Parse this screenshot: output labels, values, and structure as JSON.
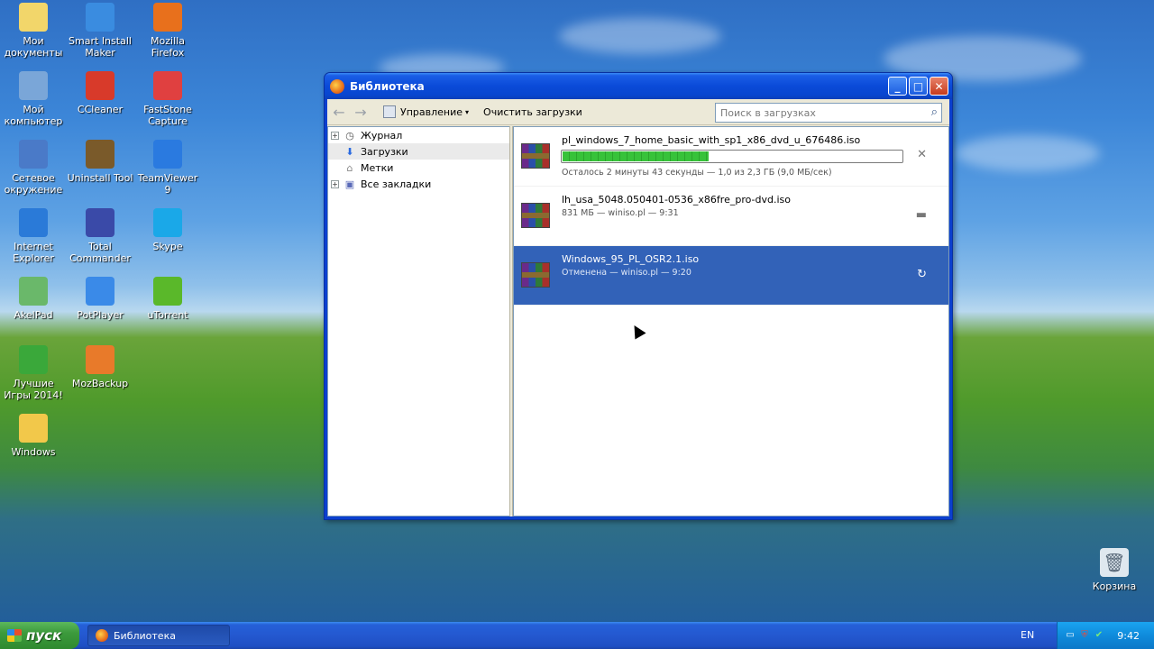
{
  "desktop": {
    "icons": [
      {
        "label": "Мои документы",
        "icon": "my-documents-icon",
        "color": "#f2d66a"
      },
      {
        "label": "Smart Install Maker",
        "icon": "smart-install-maker-icon",
        "color": "#3a8ce0"
      },
      {
        "label": "Mozilla Firefox",
        "icon": "firefox-icon",
        "color": "#e8701c"
      },
      {
        "label": "Мой компьютер",
        "icon": "my-computer-icon",
        "color": "#7aa6d8"
      },
      {
        "label": "CCleaner",
        "icon": "ccleaner-icon",
        "color": "#d83a2a"
      },
      {
        "label": "FastStone Capture",
        "icon": "faststone-capture-icon",
        "color": "#e04040"
      },
      {
        "label": "Сетевое окружение",
        "icon": "network-icon",
        "color": "#4a7ac8"
      },
      {
        "label": "Uninstall Tool",
        "icon": "uninstall-tool-icon",
        "color": "#7a5a2a"
      },
      {
        "label": "TeamViewer 9",
        "icon": "teamviewer-icon",
        "color": "#2a7ae0"
      },
      {
        "label": "Internet Explorer",
        "icon": "internet-explorer-icon",
        "color": "#2a7ad8"
      },
      {
        "label": "Total Commander",
        "icon": "total-commander-icon",
        "color": "#3a4aa8"
      },
      {
        "label": "Skype",
        "icon": "skype-icon",
        "color": "#1aa8e8"
      },
      {
        "label": "AkelPad",
        "icon": "akelpad-icon",
        "color": "#6ab86a"
      },
      {
        "label": "PotPlayer",
        "icon": "potplayer-icon",
        "color": "#3a8ae8"
      },
      {
        "label": "uTorrent",
        "icon": "utorrent-icon",
        "color": "#5ab82a"
      },
      {
        "label": "Лучшие Игры 2014!",
        "icon": "games-icon",
        "color": "#3aa83a"
      },
      {
        "label": "MozBackup",
        "icon": "mozbackup-icon",
        "color": "#e87a2a"
      },
      {
        "label": "Windows",
        "icon": "folder-icon",
        "color": "#f2c84a"
      }
    ],
    "recycle_bin": {
      "label": "Корзина",
      "icon": "recycle-bin-icon"
    }
  },
  "window": {
    "title": "Библиотека",
    "controls": {
      "minimize": "_",
      "maximize": "□",
      "close": "✕"
    },
    "toolbar": {
      "back": "←",
      "forward": "→",
      "manage_label": "Управление",
      "clear_label": "Очистить загрузки",
      "search_placeholder": "Поиск в загрузках"
    },
    "tree": [
      {
        "label": "Журнал",
        "expandable": true,
        "icon": "clock-icon",
        "selected": false
      },
      {
        "label": "Загрузки",
        "expandable": false,
        "icon": "download-arrow-icon",
        "selected": true
      },
      {
        "label": "Метки",
        "expandable": false,
        "icon": "tag-icon",
        "selected": false
      },
      {
        "label": "Все закладки",
        "expandable": true,
        "icon": "bookmarks-icon",
        "selected": false
      }
    ],
    "downloads": [
      {
        "name": "pl_windows_7_home_basic_with_sp1_x86_dvd_u_676486.iso",
        "status": "Осталось 2 минуты 43 секунды — 1,0 из 2,3 ГБ (9,0 МБ/сек)",
        "progress": 0.43,
        "action": "✕",
        "action_icon": "cancel-icon",
        "selected": false
      },
      {
        "name": "lh_usa_5048.050401-0536_x86fre_pro-dvd.iso",
        "status": "831 МБ — winiso.pl — 9:31",
        "action": "▬",
        "action_icon": "open-folder-icon",
        "selected": false
      },
      {
        "name": "Windows_95_PL_OSR2.1.iso",
        "status": "Отменена — winiso.pl — 9:20",
        "action": "↻",
        "action_icon": "retry-icon",
        "selected": true
      }
    ]
  },
  "taskbar": {
    "start_label": "пуск",
    "task_label": "Библиотека",
    "lang": "EN",
    "clock": "9:42"
  }
}
